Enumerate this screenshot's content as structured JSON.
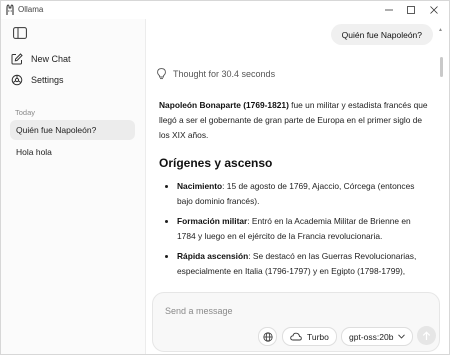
{
  "window": {
    "title": "Ollama"
  },
  "sidebar": {
    "new_chat": "New Chat",
    "settings": "Settings",
    "section": "Today",
    "chats": [
      {
        "label": "Quién fue Napoleón?",
        "active": true
      },
      {
        "label": "Hola hola",
        "active": false
      }
    ]
  },
  "chat": {
    "user_message": "Quién fue Napoleón?",
    "thought": "Thought for 30.4 seconds",
    "intro_bold": "Napoleón Bonaparte (1769-1821)",
    "intro_rest": " fue un militar y estadista francés que llegó a ser el gobernante de gran parte de Europa en el primer siglo de los XIX años.",
    "heading": "Orígenes y ascenso",
    "bullets": [
      {
        "bold": "Nacimiento",
        "text": ": 15 de agosto de 1769, Ajaccio, Córcega (entonces bajo dominio francés)."
      },
      {
        "bold": "Formación militar",
        "text": ": Entró en la Academia Militar de Brienne en 1784 y luego en el ejército de la Francia revolucionaria."
      },
      {
        "bold": "Rápida ascensión",
        "text": ": Se destacó en las Guerras Revolucionarias, especialmente en Italia (1796-1797) y en Egipto (1798-1799),"
      }
    ]
  },
  "composer": {
    "placeholder": "Send a message",
    "turbo": "Turbo",
    "model": "gpt-oss:20b"
  }
}
